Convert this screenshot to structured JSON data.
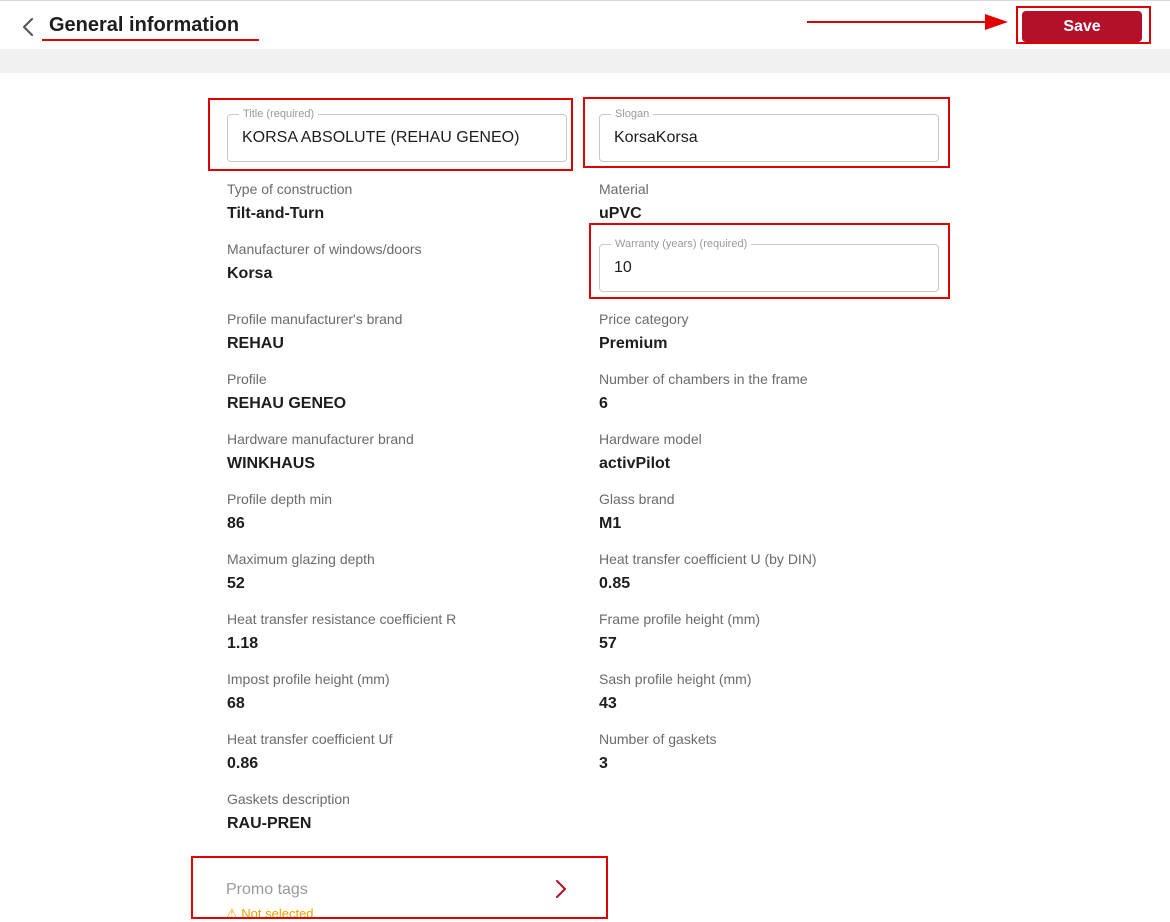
{
  "header": {
    "title": "General information",
    "save_label": "Save"
  },
  "fields": {
    "title": {
      "legend": "Title (required)",
      "value": "KORSA ABSOLUTE (REHAU GENEO)"
    },
    "slogan": {
      "legend": "Slogan",
      "value": "KorsaKorsa"
    },
    "warranty": {
      "legend": "Warranty (years) (required)",
      "value": "10"
    }
  },
  "left": [
    {
      "label": "Type of construction",
      "value": "Tilt-and-Turn"
    },
    {
      "label": "Manufacturer of windows/doors",
      "value": "Korsa"
    },
    {
      "label": "Profile manufacturer's brand",
      "value": "REHAU"
    },
    {
      "label": "Profile",
      "value": "REHAU GENEO"
    },
    {
      "label": "Hardware manufacturer brand",
      "value": "WINKHAUS"
    },
    {
      "label": "Profile depth min",
      "value": "86"
    },
    {
      "label": "Maximum glazing depth",
      "value": "52"
    },
    {
      "label": "Heat transfer resistance coefficient R",
      "value": "1.18"
    },
    {
      "label": "Impost profile height (mm)",
      "value": "68"
    },
    {
      "label": "Heat transfer coefficient Uf",
      "value": "0.86"
    },
    {
      "label": "Gaskets description",
      "value": "RAU-PREN"
    }
  ],
  "right": [
    {
      "label": "Material",
      "value": "uPVC"
    },
    {
      "label": "Price category",
      "value": "Premium"
    },
    {
      "label": "Number of chambers in the frame",
      "value": "6"
    },
    {
      "label": "Hardware model",
      "value": "activPilot"
    },
    {
      "label": "Glass brand",
      "value": "M1"
    },
    {
      "label": "Heat transfer coefficient U (by DIN)",
      "value": "0.85"
    },
    {
      "label": "Frame profile height (mm)",
      "value": "57"
    },
    {
      "label": "Sash profile height (mm)",
      "value": "43"
    },
    {
      "label": "Number of gaskets",
      "value": "3"
    }
  ],
  "promo": {
    "label": "Promo tags",
    "status": "⚠ Not selected"
  },
  "colors": {
    "accent": "#b3102a",
    "annotation": "#e10000",
    "warning": "#e6a400"
  },
  "icons": {
    "back": "chevron-left-icon",
    "promo": "chevron-right-icon"
  }
}
